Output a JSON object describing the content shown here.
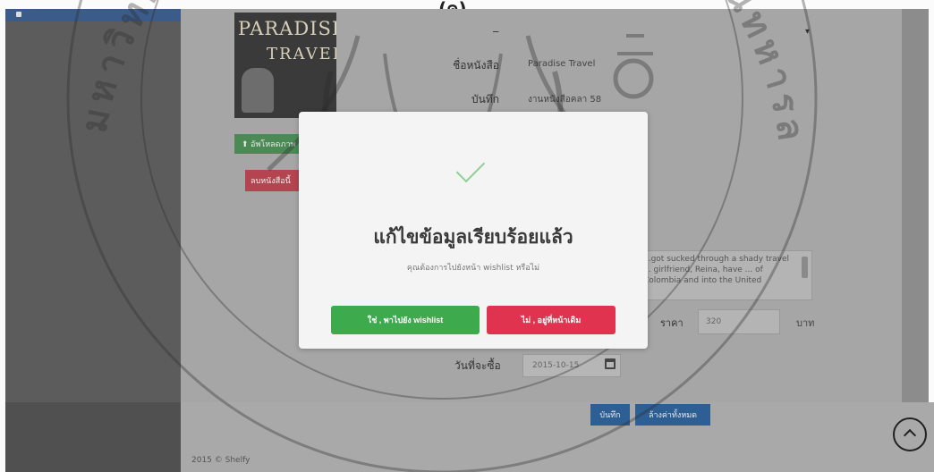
{
  "caption": "(ค)",
  "colors": {
    "confirm_button": "#3daa4e",
    "cancel_button": "#e0334f",
    "checkmark": "#8fcf95",
    "primary_button": "#2e5f94"
  },
  "book": {
    "cover_title_line1": "PARADISE",
    "cover_title_line2": "TRAVEL",
    "upload_button": "อัพโหลดภาพ",
    "delete_button": "ลบหนังสือนี้"
  },
  "form": {
    "title_label": "ชื่อหนังสือ",
    "title_value": "Paradise Travel",
    "note_label": "บันทึก",
    "note_value": "งานหนังสือคลา 58",
    "description": "...got sucked through a shady travel ... girlfriend, Reina, have ... of Colombia and into the United",
    "price_label": "ราคา",
    "price_value": "320",
    "price_unit": "บาท",
    "date_label": "วันที่จะซื้อ",
    "date_value": "2015-10-15",
    "save_button": "บันทึก",
    "clear_button": "ล้างค่าทั้งหมด"
  },
  "footer": {
    "copyright": "2015 © Shelfy"
  },
  "modal": {
    "icon": "checkmark-icon",
    "title": "แก้ไขข้อมูลเรียบร้อยแล้ว",
    "message": "คุณต้องการไปยังหน้า wishlist หรือไม่",
    "confirm_label": "ใช่ , พาไปยัง wishlist",
    "cancel_label": "ไม่ , อยู่ที่หน้าเดิม"
  },
  "watermark": {
    "text": "มหาวิทยาลัยเทคโนโลยีพระจอมเกล้าเจ้าคุณทหารลาดกระบัง"
  }
}
